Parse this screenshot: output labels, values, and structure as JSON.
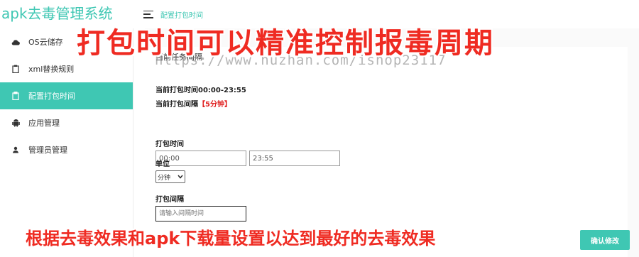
{
  "app": {
    "title": "apk去毒管理系统"
  },
  "header": {
    "breadcrumb": "配置打包时间"
  },
  "sidebar": {
    "items": [
      {
        "label": "OS云储存",
        "icon": "cloud-icon"
      },
      {
        "label": "xml替换规则",
        "icon": "clipboard-icon"
      },
      {
        "label": "配置打包时间",
        "icon": "clipboard-icon",
        "active": true
      },
      {
        "label": "应用管理",
        "icon": "android-icon"
      },
      {
        "label": "管理员管理",
        "icon": "user-icon"
      }
    ]
  },
  "form": {
    "section_title": "当前任务间隔",
    "current_time": "当前打包时间00:00-23:55",
    "interval_prefix": "当前打包间隔",
    "interval_value": "【5分钟】",
    "pack_time_label": "打包时间",
    "start_value": "00:00",
    "end_value": "23:55",
    "unit_label": "单位",
    "unit_selected": "分钟",
    "interval_label": "打包间隔",
    "interval_placeholder": "请输入间隔时间",
    "confirm_label": "确认修改"
  },
  "overlay": {
    "top_banner": "打包时间可以精准控制报毒周期",
    "watermark": "https://www.huzhan.com/ishop23117",
    "bottom_banner": "根据去毒效果和apk下载量设置以达到最好的去毒效果"
  },
  "colors": {
    "accent": "#3fc7b3",
    "banner": "#ef2b22",
    "highlight": "#e02020"
  }
}
